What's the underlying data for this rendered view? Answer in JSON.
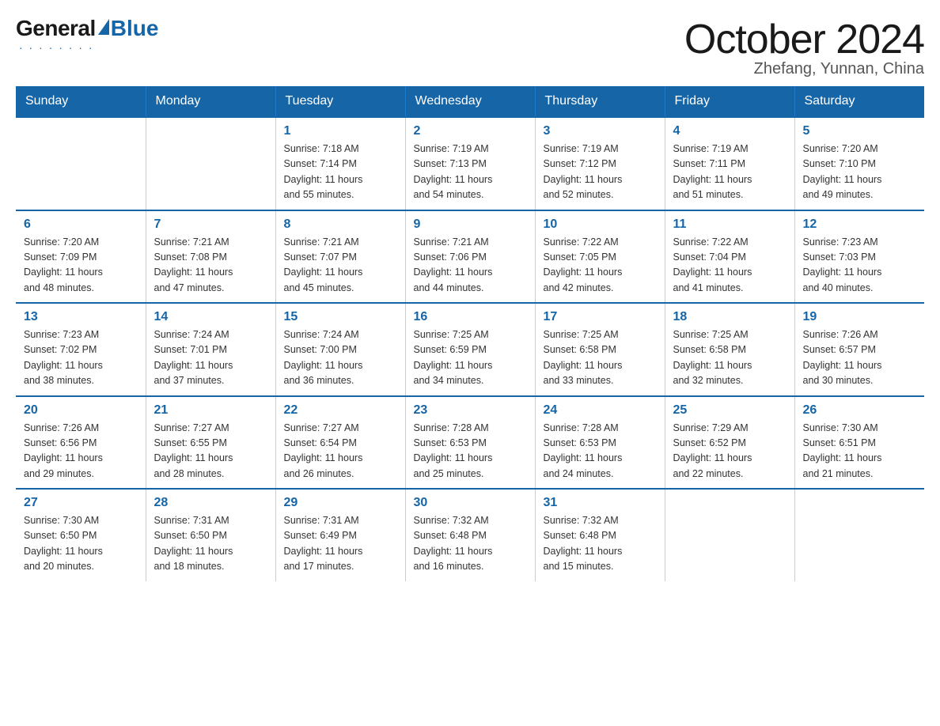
{
  "logo": {
    "general": "General",
    "blue": "Blue",
    "tagline": "Blue"
  },
  "header": {
    "month_title": "October 2024",
    "location": "Zhefang, Yunnan, China"
  },
  "weekdays": [
    "Sunday",
    "Monday",
    "Tuesday",
    "Wednesday",
    "Thursday",
    "Friday",
    "Saturday"
  ],
  "weeks": [
    [
      {
        "day": "",
        "info": ""
      },
      {
        "day": "",
        "info": ""
      },
      {
        "day": "1",
        "info": "Sunrise: 7:18 AM\nSunset: 7:14 PM\nDaylight: 11 hours\nand 55 minutes."
      },
      {
        "day": "2",
        "info": "Sunrise: 7:19 AM\nSunset: 7:13 PM\nDaylight: 11 hours\nand 54 minutes."
      },
      {
        "day": "3",
        "info": "Sunrise: 7:19 AM\nSunset: 7:12 PM\nDaylight: 11 hours\nand 52 minutes."
      },
      {
        "day": "4",
        "info": "Sunrise: 7:19 AM\nSunset: 7:11 PM\nDaylight: 11 hours\nand 51 minutes."
      },
      {
        "day": "5",
        "info": "Sunrise: 7:20 AM\nSunset: 7:10 PM\nDaylight: 11 hours\nand 49 minutes."
      }
    ],
    [
      {
        "day": "6",
        "info": "Sunrise: 7:20 AM\nSunset: 7:09 PM\nDaylight: 11 hours\nand 48 minutes."
      },
      {
        "day": "7",
        "info": "Sunrise: 7:21 AM\nSunset: 7:08 PM\nDaylight: 11 hours\nand 47 minutes."
      },
      {
        "day": "8",
        "info": "Sunrise: 7:21 AM\nSunset: 7:07 PM\nDaylight: 11 hours\nand 45 minutes."
      },
      {
        "day": "9",
        "info": "Sunrise: 7:21 AM\nSunset: 7:06 PM\nDaylight: 11 hours\nand 44 minutes."
      },
      {
        "day": "10",
        "info": "Sunrise: 7:22 AM\nSunset: 7:05 PM\nDaylight: 11 hours\nand 42 minutes."
      },
      {
        "day": "11",
        "info": "Sunrise: 7:22 AM\nSunset: 7:04 PM\nDaylight: 11 hours\nand 41 minutes."
      },
      {
        "day": "12",
        "info": "Sunrise: 7:23 AM\nSunset: 7:03 PM\nDaylight: 11 hours\nand 40 minutes."
      }
    ],
    [
      {
        "day": "13",
        "info": "Sunrise: 7:23 AM\nSunset: 7:02 PM\nDaylight: 11 hours\nand 38 minutes."
      },
      {
        "day": "14",
        "info": "Sunrise: 7:24 AM\nSunset: 7:01 PM\nDaylight: 11 hours\nand 37 minutes."
      },
      {
        "day": "15",
        "info": "Sunrise: 7:24 AM\nSunset: 7:00 PM\nDaylight: 11 hours\nand 36 minutes."
      },
      {
        "day": "16",
        "info": "Sunrise: 7:25 AM\nSunset: 6:59 PM\nDaylight: 11 hours\nand 34 minutes."
      },
      {
        "day": "17",
        "info": "Sunrise: 7:25 AM\nSunset: 6:58 PM\nDaylight: 11 hours\nand 33 minutes."
      },
      {
        "day": "18",
        "info": "Sunrise: 7:25 AM\nSunset: 6:58 PM\nDaylight: 11 hours\nand 32 minutes."
      },
      {
        "day": "19",
        "info": "Sunrise: 7:26 AM\nSunset: 6:57 PM\nDaylight: 11 hours\nand 30 minutes."
      }
    ],
    [
      {
        "day": "20",
        "info": "Sunrise: 7:26 AM\nSunset: 6:56 PM\nDaylight: 11 hours\nand 29 minutes."
      },
      {
        "day": "21",
        "info": "Sunrise: 7:27 AM\nSunset: 6:55 PM\nDaylight: 11 hours\nand 28 minutes."
      },
      {
        "day": "22",
        "info": "Sunrise: 7:27 AM\nSunset: 6:54 PM\nDaylight: 11 hours\nand 26 minutes."
      },
      {
        "day": "23",
        "info": "Sunrise: 7:28 AM\nSunset: 6:53 PM\nDaylight: 11 hours\nand 25 minutes."
      },
      {
        "day": "24",
        "info": "Sunrise: 7:28 AM\nSunset: 6:53 PM\nDaylight: 11 hours\nand 24 minutes."
      },
      {
        "day": "25",
        "info": "Sunrise: 7:29 AM\nSunset: 6:52 PM\nDaylight: 11 hours\nand 22 minutes."
      },
      {
        "day": "26",
        "info": "Sunrise: 7:30 AM\nSunset: 6:51 PM\nDaylight: 11 hours\nand 21 minutes."
      }
    ],
    [
      {
        "day": "27",
        "info": "Sunrise: 7:30 AM\nSunset: 6:50 PM\nDaylight: 11 hours\nand 20 minutes."
      },
      {
        "day": "28",
        "info": "Sunrise: 7:31 AM\nSunset: 6:50 PM\nDaylight: 11 hours\nand 18 minutes."
      },
      {
        "day": "29",
        "info": "Sunrise: 7:31 AM\nSunset: 6:49 PM\nDaylight: 11 hours\nand 17 minutes."
      },
      {
        "day": "30",
        "info": "Sunrise: 7:32 AM\nSunset: 6:48 PM\nDaylight: 11 hours\nand 16 minutes."
      },
      {
        "day": "31",
        "info": "Sunrise: 7:32 AM\nSunset: 6:48 PM\nDaylight: 11 hours\nand 15 minutes."
      },
      {
        "day": "",
        "info": ""
      },
      {
        "day": "",
        "info": ""
      }
    ]
  ]
}
